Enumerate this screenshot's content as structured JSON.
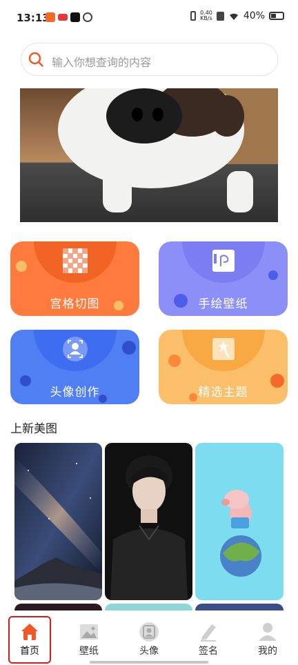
{
  "status_bar": {
    "time": "13:13",
    "net_speed_top": "0.40",
    "net_speed_bottom": "KB/s",
    "battery": "40%"
  },
  "search": {
    "placeholder": "输入你想查询的内容",
    "icon": "search-icon"
  },
  "banner": {
    "icon": "dog-photo"
  },
  "features": [
    {
      "label": "宫格切图",
      "icon": "grid-icon",
      "color": "#ff7a3d"
    },
    {
      "label": "手绘壁纸",
      "icon": "drawing-icon",
      "color": "#8c8ff8"
    },
    {
      "label": "头像创作",
      "icon": "avatar-icon",
      "color": "#4f7ff3"
    },
    {
      "label": "精选主题",
      "icon": "star-wand-icon",
      "color": "#fbbf6a"
    }
  ],
  "section": {
    "title": "上新美图"
  },
  "tabs": [
    {
      "label": "首页",
      "icon": "home-icon",
      "active": true
    },
    {
      "label": "壁纸",
      "icon": "image-icon",
      "active": false
    },
    {
      "label": "头像",
      "icon": "portrait-icon",
      "active": false
    },
    {
      "label": "签名",
      "icon": "pen-icon",
      "active": false
    },
    {
      "label": "我的",
      "icon": "user-icon",
      "active": false
    }
  ],
  "colors": {
    "accent": "#f0582a",
    "highlight": "#d71a1a"
  }
}
